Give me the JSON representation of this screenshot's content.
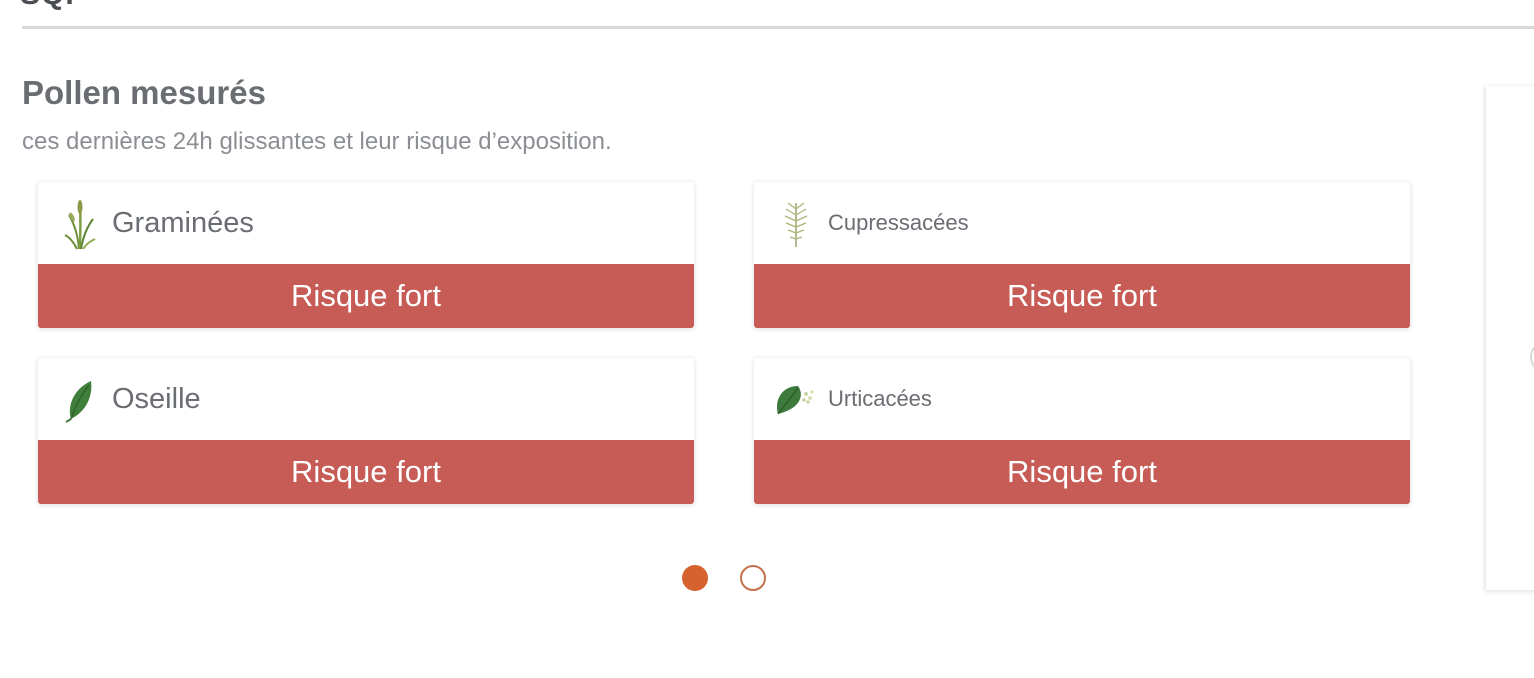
{
  "header": {
    "cut_title": "SQI"
  },
  "section": {
    "title": "Pollen mesurés",
    "subtitle": "ces dernières 24h glissantes et leur risque d’exposition."
  },
  "cards": [
    {
      "name": "Graminées",
      "icon": "grass-icon",
      "risk": "Risque fort",
      "risk_color": "#c75b55"
    },
    {
      "name": "Cupressacées",
      "icon": "cypress-icon",
      "risk": "Risque fort",
      "risk_color": "#c75b55"
    },
    {
      "name": "Oseille",
      "icon": "sorrel-leaf-icon",
      "risk": "Risque fort",
      "risk_color": "#c75b55"
    },
    {
      "name": "Urticacées",
      "icon": "nettle-leaf-icon",
      "risk": "Risque fort",
      "risk_color": "#c75b55"
    }
  ],
  "pagination": {
    "pages": 2,
    "current": 1,
    "active_color": "#d5622f"
  }
}
